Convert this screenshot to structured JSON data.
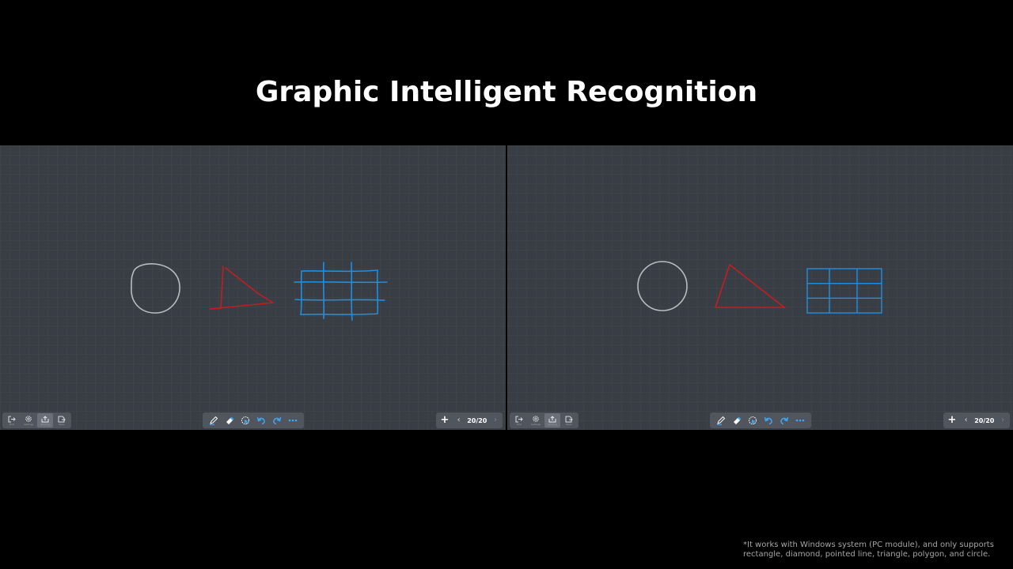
{
  "slide": {
    "title": "Graphic Intelligent Recognition",
    "footnote_line1": "*It works with Windows system (PC module), and only supports",
    "footnote_line2": "rectangle, diamond, pointed line, triangle, polygon, and circle."
  },
  "panels": [
    {
      "id": "before",
      "shapes": [
        "circle",
        "triangle",
        "grid-table"
      ],
      "style": "freehand",
      "left_toolbar": {
        "items": [
          {
            "icon": "exit-icon",
            "label": "Exit"
          },
          {
            "icon": "settings-gear-icon",
            "label": "Settings"
          },
          {
            "icon": "share-icon",
            "label": "Sharing",
            "active": true
          },
          {
            "icon": "open-file-icon",
            "label": "Open"
          }
        ]
      },
      "tools": [
        "pen-icon",
        "eraser-icon",
        "lasso-select-icon",
        "undo-icon",
        "redo-icon",
        "more-icon"
      ],
      "page_indicator": "20/20"
    },
    {
      "id": "after",
      "shapes": [
        "circle",
        "triangle",
        "grid-table"
      ],
      "style": "recognized",
      "left_toolbar": {
        "items": [
          {
            "icon": "exit-icon",
            "label": "Exit"
          },
          {
            "icon": "settings-gear-icon",
            "label": "Settings"
          },
          {
            "icon": "share-icon",
            "label": "Sharing",
            "active": true
          },
          {
            "icon": "open-file-icon",
            "label": "Open"
          }
        ]
      },
      "tools": [
        "pen-icon",
        "eraser-icon",
        "lasso-select-icon",
        "undo-icon",
        "redo-icon",
        "more-icon"
      ],
      "page_indicator": "20/20"
    }
  ],
  "colors": {
    "background": "#000000",
    "canvas": "#393d45",
    "toolbar": "#50555e",
    "circle_stroke": "#b9bcc1",
    "triangle_stroke": "#c01f1f",
    "grid_stroke": "#1f8fe0",
    "accent_blue": "#3ea7f2"
  }
}
